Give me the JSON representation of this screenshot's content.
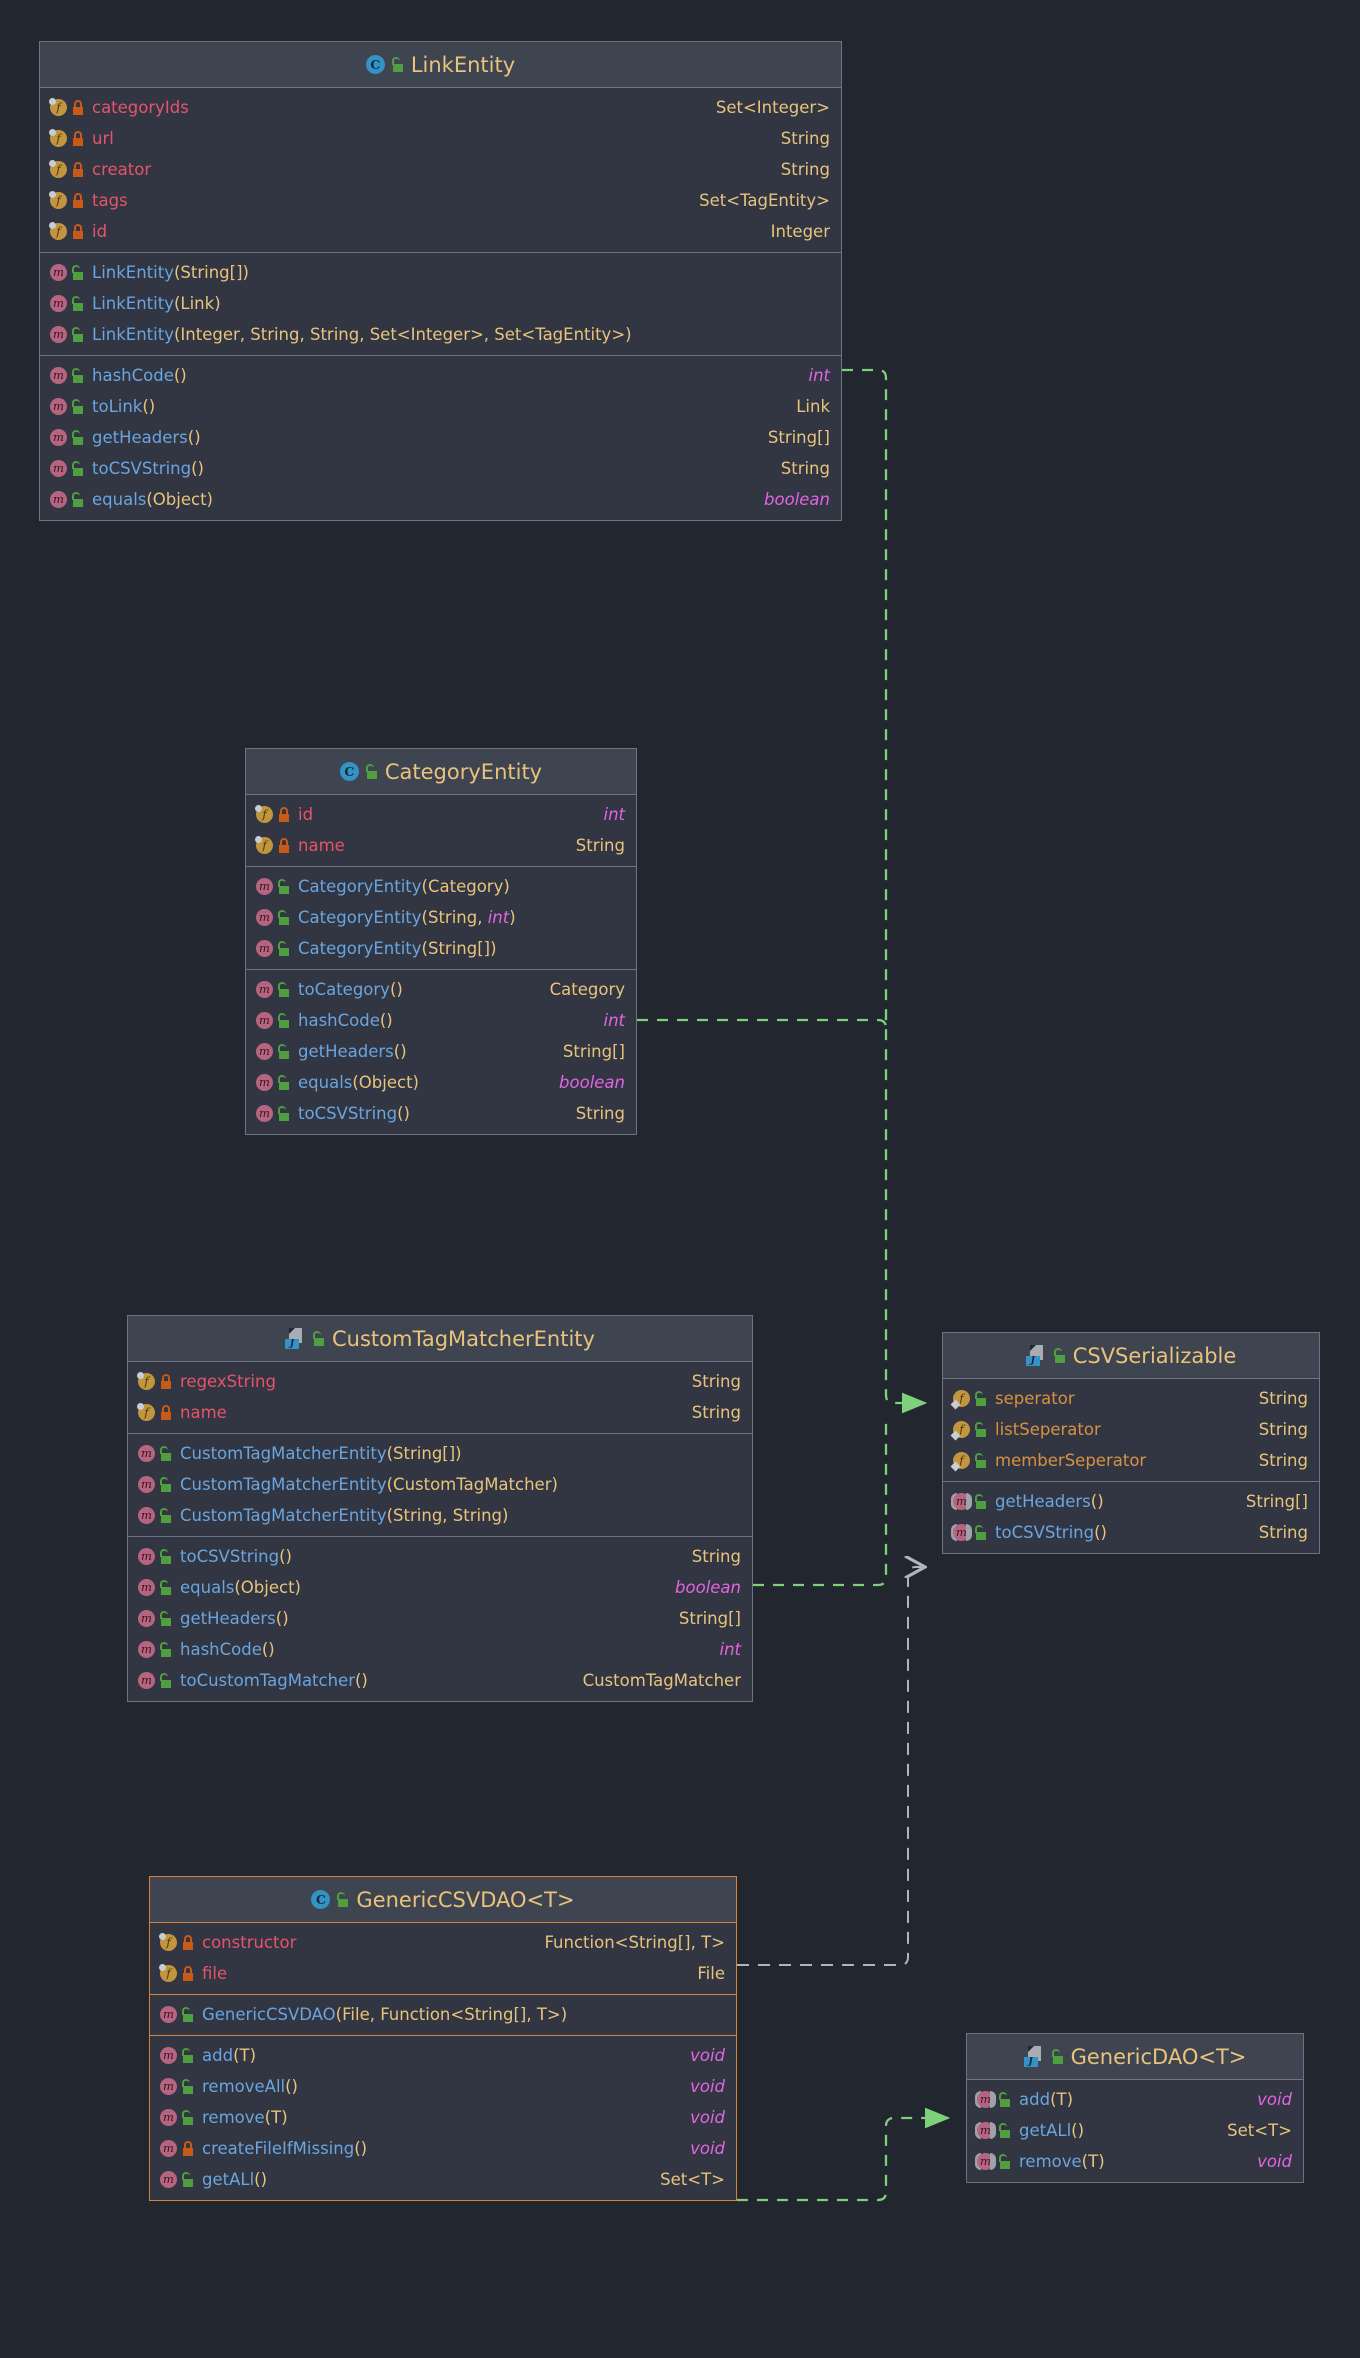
{
  "theme": {
    "background": "#22262e",
    "class_body": "#313642",
    "class_header": "#3e4450",
    "border": "#6d7380",
    "highlight_border": "#d4813a",
    "title_color": "#e9c37c",
    "field_name_color": "#e8536b",
    "interface_field_color": "#d9913f",
    "method_name_color": "#6aa5e0",
    "type_color": "#e9c37c",
    "primitive_color": "#e265e2",
    "implements_edge": "#7ed07a",
    "dependency_edge": "#b0b4bd"
  },
  "diagram": {
    "kind": "uml-class-diagram",
    "classes": [
      {
        "id": "LinkEntity",
        "name": "LinkEntity",
        "stereotype": "class",
        "icon": "class-icon",
        "visibility": "public",
        "highlighted": false,
        "sections": [
          {
            "kind": "fields",
            "members": [
              {
                "icon": "field-icon",
                "visibility": "private",
                "name": "categoryIds",
                "type": "Set<Integer>",
                "primitive": false
              },
              {
                "icon": "field-icon",
                "visibility": "private",
                "name": "url",
                "type": "String",
                "primitive": false
              },
              {
                "icon": "field-icon",
                "visibility": "private",
                "name": "creator",
                "type": "String",
                "primitive": false
              },
              {
                "icon": "field-icon",
                "visibility": "private",
                "name": "tags",
                "type": "Set<TagEntity>",
                "primitive": false
              },
              {
                "icon": "field-icon",
                "visibility": "private",
                "name": "id",
                "type": "Integer",
                "primitive": false
              }
            ]
          },
          {
            "kind": "constructors",
            "members": [
              {
                "icon": "method-icon",
                "visibility": "public",
                "name": "LinkEntity",
                "params": "(String[])",
                "type": ""
              },
              {
                "icon": "method-icon",
                "visibility": "public",
                "name": "LinkEntity",
                "params": "(Link)",
                "type": ""
              },
              {
                "icon": "method-icon",
                "visibility": "public",
                "name": "LinkEntity",
                "params": "(Integer, String, String, Set<Integer>, Set<TagEntity>)",
                "type": ""
              }
            ]
          },
          {
            "kind": "methods",
            "members": [
              {
                "icon": "method-icon",
                "visibility": "public",
                "name": "hashCode",
                "params": "()",
                "type": "int",
                "primitive": true
              },
              {
                "icon": "method-icon",
                "visibility": "public",
                "name": "toLink",
                "params": "()",
                "type": "Link",
                "primitive": false
              },
              {
                "icon": "method-icon",
                "visibility": "public",
                "name": "getHeaders",
                "params": "()",
                "type": "String[]",
                "primitive": false
              },
              {
                "icon": "method-icon",
                "visibility": "public",
                "name": "toCSVString",
                "params": "()",
                "type": "String",
                "primitive": false
              },
              {
                "icon": "method-icon",
                "visibility": "public",
                "name": "equals",
                "params": "(Object)",
                "type": "boolean",
                "primitive": true
              }
            ]
          }
        ]
      },
      {
        "id": "CategoryEntity",
        "name": "CategoryEntity",
        "stereotype": "class",
        "icon": "class-icon",
        "visibility": "public",
        "highlighted": false,
        "sections": [
          {
            "kind": "fields",
            "members": [
              {
                "icon": "field-icon",
                "visibility": "private",
                "name": "id",
                "type": "int",
                "primitive": true
              },
              {
                "icon": "field-icon",
                "visibility": "private",
                "name": "name",
                "type": "String",
                "primitive": false
              }
            ]
          },
          {
            "kind": "constructors",
            "members": [
              {
                "icon": "method-icon",
                "visibility": "public",
                "name": "CategoryEntity",
                "params": "(Category)",
                "type": ""
              },
              {
                "icon": "method-icon",
                "visibility": "public",
                "name": "CategoryEntity",
                "params": "(String, int)",
                "type": "",
                "param_primitives": [
                  "int"
                ]
              },
              {
                "icon": "method-icon",
                "visibility": "public",
                "name": "CategoryEntity",
                "params": "(String[])",
                "type": ""
              }
            ]
          },
          {
            "kind": "methods",
            "members": [
              {
                "icon": "method-icon",
                "visibility": "public",
                "name": "toCategory",
                "params": "()",
                "type": "Category",
                "primitive": false
              },
              {
                "icon": "method-icon",
                "visibility": "public",
                "name": "hashCode",
                "params": "()",
                "type": "int",
                "primitive": true
              },
              {
                "icon": "method-icon",
                "visibility": "public",
                "name": "getHeaders",
                "params": "()",
                "type": "String[]",
                "primitive": false
              },
              {
                "icon": "method-icon",
                "visibility": "public",
                "name": "equals",
                "params": "(Object)",
                "type": "boolean",
                "primitive": true
              },
              {
                "icon": "method-icon",
                "visibility": "public",
                "name": "toCSVString",
                "params": "()",
                "type": "String",
                "primitive": false
              }
            ]
          }
        ]
      },
      {
        "id": "CustomTagMatcherEntity",
        "name": "CustomTagMatcherEntity",
        "stereotype": "java-file",
        "icon": "java-file-icon",
        "visibility": "public",
        "highlighted": false,
        "sections": [
          {
            "kind": "fields",
            "members": [
              {
                "icon": "field-icon",
                "visibility": "private",
                "name": "regexString",
                "type": "String",
                "primitive": false
              },
              {
                "icon": "field-icon",
                "visibility": "private",
                "name": "name",
                "type": "String",
                "primitive": false
              }
            ]
          },
          {
            "kind": "constructors",
            "members": [
              {
                "icon": "method-icon",
                "visibility": "public",
                "name": "CustomTagMatcherEntity",
                "params": "(String[])",
                "type": ""
              },
              {
                "icon": "method-icon",
                "visibility": "public",
                "name": "CustomTagMatcherEntity",
                "params": "(CustomTagMatcher)",
                "type": ""
              },
              {
                "icon": "method-icon",
                "visibility": "public",
                "name": "CustomTagMatcherEntity",
                "params": "(String, String)",
                "type": ""
              }
            ]
          },
          {
            "kind": "methods",
            "members": [
              {
                "icon": "method-icon",
                "visibility": "public",
                "name": "toCSVString",
                "params": "()",
                "type": "String",
                "primitive": false
              },
              {
                "icon": "method-icon",
                "visibility": "public",
                "name": "equals",
                "params": "(Object)",
                "type": "boolean",
                "primitive": true
              },
              {
                "icon": "method-icon",
                "visibility": "public",
                "name": "getHeaders",
                "params": "()",
                "type": "String[]",
                "primitive": false
              },
              {
                "icon": "method-icon",
                "visibility": "public",
                "name": "hashCode",
                "params": "()",
                "type": "int",
                "primitive": true
              },
              {
                "icon": "method-icon",
                "visibility": "public",
                "name": "toCustomTagMatcher",
                "params": "()",
                "type": "CustomTagMatcher",
                "primitive": false
              }
            ]
          }
        ]
      },
      {
        "id": "CSVSerializable",
        "name": "CSVSerializable",
        "stereotype": "java-file",
        "icon": "java-file-icon",
        "visibility": "public",
        "highlighted": false,
        "sections": [
          {
            "kind": "fields",
            "members": [
              {
                "icon": "field-icon",
                "visibility": "public",
                "name": "seperator",
                "type": "String",
                "primitive": false,
                "static_final": true,
                "interface_member": true
              },
              {
                "icon": "field-icon",
                "visibility": "public",
                "name": "listSeperator",
                "type": "String",
                "primitive": false,
                "static_final": true,
                "interface_member": true
              },
              {
                "icon": "field-icon",
                "visibility": "public",
                "name": "memberSeperator",
                "type": "String",
                "primitive": false,
                "static_final": true,
                "interface_member": true
              }
            ]
          },
          {
            "kind": "methods",
            "members": [
              {
                "icon": "method-icon",
                "visibility": "public",
                "name": "getHeaders",
                "params": "()",
                "type": "String[]",
                "primitive": false,
                "abstract": true
              },
              {
                "icon": "method-icon",
                "visibility": "public",
                "name": "toCSVString",
                "params": "()",
                "type": "String",
                "primitive": false,
                "abstract": true
              }
            ]
          }
        ]
      },
      {
        "id": "GenericCSVDAO",
        "name": "GenericCSVDAO<T>",
        "stereotype": "class",
        "icon": "class-icon",
        "visibility": "public",
        "highlighted": true,
        "sections": [
          {
            "kind": "fields",
            "members": [
              {
                "icon": "field-icon",
                "visibility": "private",
                "name": "constructor",
                "type": "Function<String[], T>",
                "primitive": false
              },
              {
                "icon": "field-icon",
                "visibility": "private",
                "name": "file",
                "type": "File",
                "primitive": false
              }
            ]
          },
          {
            "kind": "constructors",
            "members": [
              {
                "icon": "method-icon",
                "visibility": "public",
                "name": "GenericCSVDAO",
                "params": "(File, Function<String[], T>)",
                "type": ""
              }
            ]
          },
          {
            "kind": "methods",
            "members": [
              {
                "icon": "method-icon",
                "visibility": "public",
                "name": "add",
                "params": "(T)",
                "type": "void",
                "primitive": true
              },
              {
                "icon": "method-icon",
                "visibility": "public",
                "name": "removeAll",
                "params": "()",
                "type": "void",
                "primitive": true
              },
              {
                "icon": "method-icon",
                "visibility": "public",
                "name": "remove",
                "params": "(T)",
                "type": "void",
                "primitive": true
              },
              {
                "icon": "method-icon",
                "visibility": "private",
                "name": "createFileIfMissing",
                "params": "()",
                "type": "void",
                "primitive": true
              },
              {
                "icon": "method-icon",
                "visibility": "public",
                "name": "getALl",
                "params": "()",
                "type": "Set<T>",
                "primitive": false
              }
            ]
          }
        ]
      },
      {
        "id": "GenericDAO",
        "name": "GenericDAO<T>",
        "stereotype": "java-file",
        "icon": "java-file-icon",
        "visibility": "public",
        "highlighted": false,
        "sections": [
          {
            "kind": "methods",
            "members": [
              {
                "icon": "method-icon",
                "visibility": "public",
                "name": "add",
                "params": "(T)",
                "type": "void",
                "primitive": true,
                "abstract": true
              },
              {
                "icon": "method-icon",
                "visibility": "public",
                "name": "getALl",
                "params": "()",
                "type": "Set<T>",
                "primitive": false,
                "abstract": true
              },
              {
                "icon": "method-icon",
                "visibility": "public",
                "name": "remove",
                "params": "(T)",
                "type": "void",
                "primitive": true,
                "abstract": true
              }
            ]
          }
        ]
      }
    ],
    "edges": [
      {
        "from": "LinkEntity",
        "to": "CSVSerializable",
        "style": "implements",
        "color": "#7ed07a",
        "arrow": "filled"
      },
      {
        "from": "CategoryEntity",
        "to": "CSVSerializable",
        "style": "implements",
        "color": "#7ed07a",
        "arrow": "filled"
      },
      {
        "from": "CustomTagMatcherEntity",
        "to": "CSVSerializable",
        "style": "implements",
        "color": "#7ed07a",
        "arrow": "filled"
      },
      {
        "from": "GenericCSVDAO",
        "to": "CSVSerializable",
        "style": "dependency",
        "color": "#b0b4bd",
        "arrow": "open"
      },
      {
        "from": "GenericCSVDAO",
        "to": "GenericDAO",
        "style": "implements",
        "color": "#7ed07a",
        "arrow": "filled"
      }
    ]
  }
}
